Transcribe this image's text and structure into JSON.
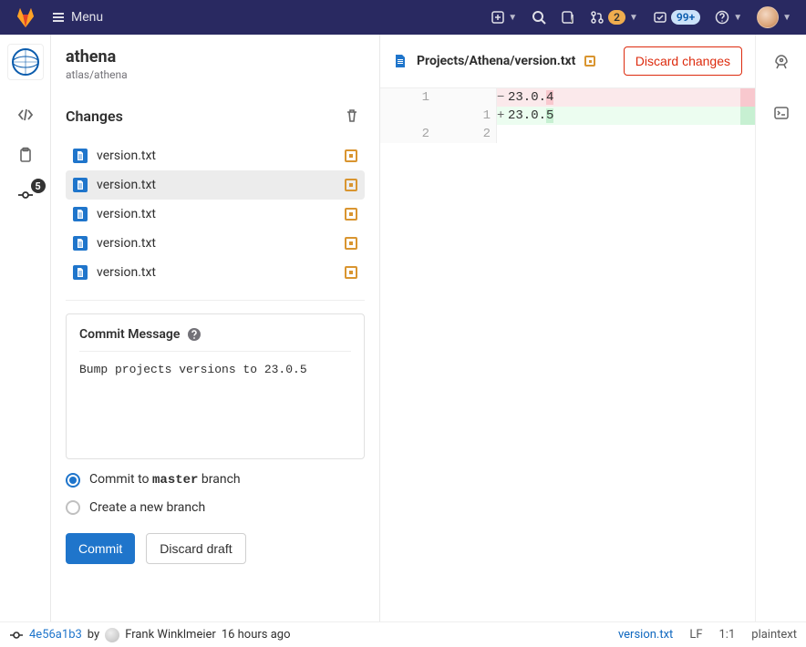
{
  "topbar": {
    "menu_label": "Menu",
    "mr_badge": "2",
    "todo_badge": "99+"
  },
  "rail": {
    "project_logo_text": "ATLAS\nEXPERIMENT",
    "commit_count": "5"
  },
  "project": {
    "name": "athena",
    "path": "atlas/athena"
  },
  "panel": {
    "changes_label": "Changes",
    "files": [
      {
        "name": "version.txt"
      },
      {
        "name": "version.txt"
      },
      {
        "name": "version.txt"
      },
      {
        "name": "version.txt"
      },
      {
        "name": "version.txt"
      }
    ],
    "selected_index": 1,
    "commit_message_label": "Commit Message",
    "commit_message_value": "Bump projects versions to 23.0.5",
    "radio_commit_to_prefix": "Commit to ",
    "radio_commit_to_branch": "master",
    "radio_commit_to_suffix": " branch",
    "radio_new_branch": "Create a new branch",
    "commit_btn": "Commit",
    "discard_draft_btn": "Discard draft"
  },
  "editor": {
    "breadcrumb": "Projects/Athena/version.txt",
    "discard_btn": "Discard changes",
    "diff": {
      "line1_old": "1",
      "line1_new": "1",
      "removed_prefix": "23.0.",
      "removed_changed": "4",
      "added_prefix": "23.0.",
      "added_changed": "5",
      "line2_old": "2",
      "line2_new": "2"
    }
  },
  "statusbar": {
    "sha": "4e56a1b3",
    "by": "by",
    "author": "Frank Winklmeier",
    "time": "16 hours ago",
    "filename": "version.txt",
    "eol": "LF",
    "pos": "1:1",
    "lang": "plaintext"
  }
}
